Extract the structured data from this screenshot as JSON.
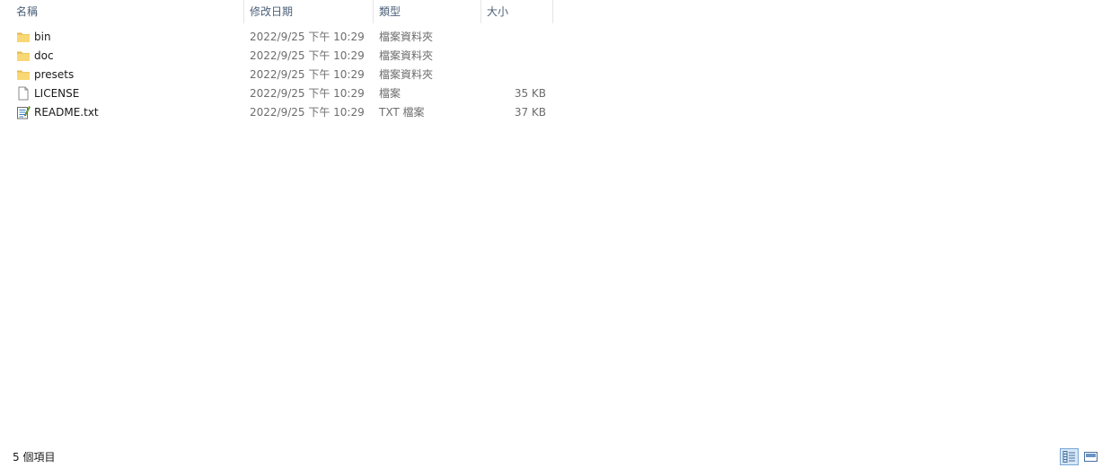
{
  "columns": {
    "name": "名稱",
    "date": "修改日期",
    "type": "類型",
    "size": "大小",
    "sort_indicator": "^"
  },
  "files": [
    {
      "name": "bin",
      "modified": "2022/9/25 下午 10:29",
      "type": "檔案資料夾",
      "size": "",
      "icon": "folder-icon"
    },
    {
      "name": "doc",
      "modified": "2022/9/25 下午 10:29",
      "type": "檔案資料夾",
      "size": "",
      "icon": "folder-icon"
    },
    {
      "name": "presets",
      "modified": "2022/9/25 下午 10:29",
      "type": "檔案資料夾",
      "size": "",
      "icon": "folder-icon"
    },
    {
      "name": "LICENSE",
      "modified": "2022/9/25 下午 10:29",
      "type": "檔案",
      "size": "35 KB",
      "icon": "file-icon"
    },
    {
      "name": "README.txt",
      "modified": "2022/9/25 下午 10:29",
      "type": "TXT 檔案",
      "size": "37 KB",
      "icon": "text-file-icon"
    }
  ],
  "status": {
    "item_count": "5 個項目"
  },
  "view_buttons": {
    "details_icon": "details-view-icon",
    "tiles_icon": "large-icons-view-icon"
  },
  "colors": {
    "header_text": "#4c607a",
    "folder": "#f8d775",
    "selected_view": "#d6e7f7"
  }
}
